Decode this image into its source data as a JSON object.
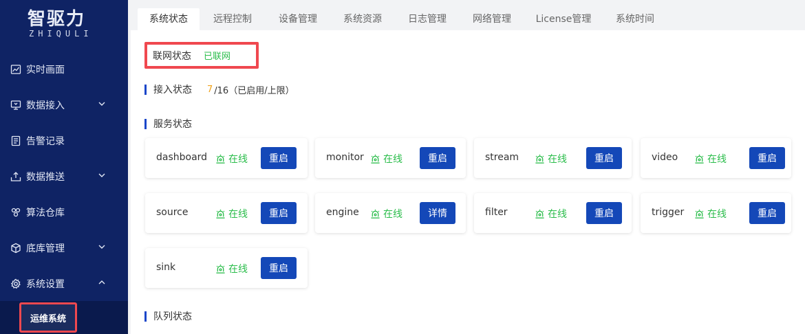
{
  "logo": {
    "main": "智驱力",
    "sub": "ZHIQULI"
  },
  "sidebar": {
    "items": [
      {
        "label": "实时画面",
        "icon": "chart-icon",
        "has_chevron": false
      },
      {
        "label": "数据接入",
        "icon": "monitor-icon",
        "has_chevron": true,
        "chevron": "down"
      },
      {
        "label": "告警记录",
        "icon": "document-icon",
        "has_chevron": false
      },
      {
        "label": "数据推送",
        "icon": "upload-tray-icon",
        "has_chevron": true,
        "chevron": "down"
      },
      {
        "label": "算法仓库",
        "icon": "cluster-icon",
        "has_chevron": false
      },
      {
        "label": "底库管理",
        "icon": "cube-icon",
        "has_chevron": true,
        "chevron": "down"
      },
      {
        "label": "系统设置",
        "icon": "gear-icon",
        "has_chevron": true,
        "chevron": "up"
      }
    ],
    "active_sub": "运维系统"
  },
  "tabs": [
    "系统状态",
    "远程控制",
    "设备管理",
    "系统资源",
    "日志管理",
    "网络管理",
    "License管理",
    "系统时间"
  ],
  "active_tab": "系统状态",
  "network": {
    "label": "联网状态",
    "value": "已联网"
  },
  "access": {
    "label": "接入状态",
    "current": "7",
    "rest": "/16（已启用/上限）"
  },
  "services_title": "服务状态",
  "queue_title": "队列状态",
  "services": [
    {
      "name": "dashboard",
      "status": "在线",
      "action": "重启"
    },
    {
      "name": "monitor",
      "status": "在线",
      "action": "重启"
    },
    {
      "name": "stream",
      "status": "在线",
      "action": "重启"
    },
    {
      "name": "video",
      "status": "在线",
      "action": "重启"
    },
    {
      "name": "source",
      "status": "在线",
      "action": "重启"
    },
    {
      "name": "engine",
      "status": "在线",
      "action": "详情"
    },
    {
      "name": "filter",
      "status": "在线",
      "action": "重启"
    },
    {
      "name": "trigger",
      "status": "在线",
      "action": "重启"
    },
    {
      "name": "sink",
      "status": "在线",
      "action": "重启"
    }
  ],
  "colors": {
    "sidebar_bg": "#0f2364",
    "accent_blue": "#1448b8",
    "online_green": "#2bbd4b",
    "highlight_red": "#f0484f",
    "count_orange": "#f0a21a"
  }
}
